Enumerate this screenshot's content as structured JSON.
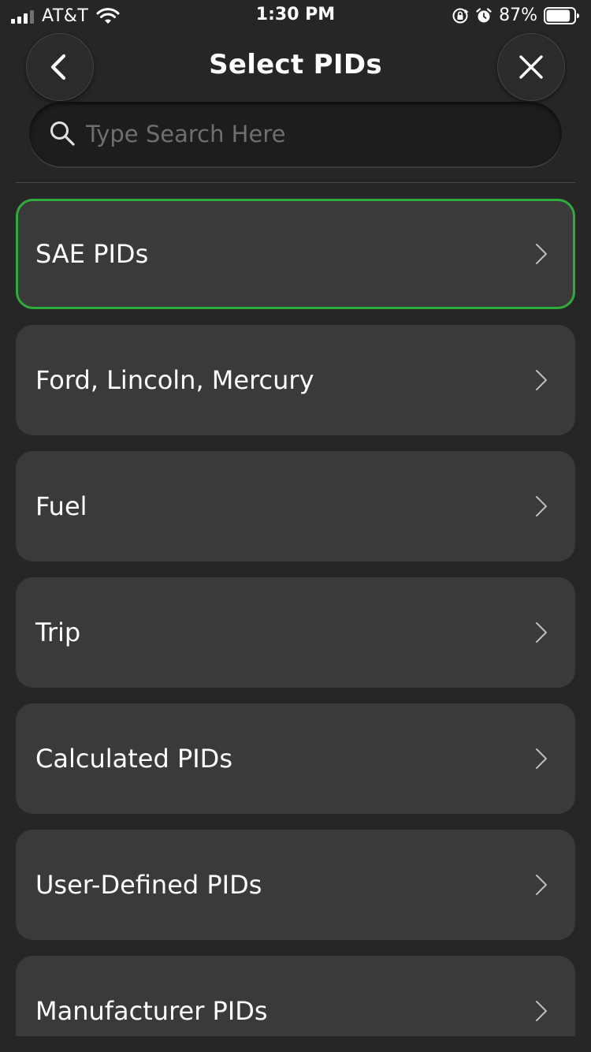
{
  "status_bar": {
    "carrier": "AT&T",
    "time": "1:30 PM",
    "battery": "87%",
    "battery_fraction": 0.87
  },
  "header": {
    "title": "Select PIDs",
    "back_icon": "chevron-left-icon",
    "close_icon": "close-icon"
  },
  "search": {
    "placeholder": "Type Search Here",
    "value": ""
  },
  "colors": {
    "background": "#262626",
    "card": "#3a3a3a",
    "selected_border": "#2faa3c",
    "placeholder": "#6f6f6f"
  },
  "list": {
    "items": [
      {
        "label": "SAE PIDs",
        "selected": true
      },
      {
        "label": "Ford, Lincoln, Mercury",
        "selected": false
      },
      {
        "label": "Fuel",
        "selected": false
      },
      {
        "label": "Trip",
        "selected": false
      },
      {
        "label": "Calculated PIDs",
        "selected": false
      },
      {
        "label": "User-Defined PIDs",
        "selected": false
      },
      {
        "label": "Manufacturer PIDs",
        "selected": false
      }
    ]
  }
}
